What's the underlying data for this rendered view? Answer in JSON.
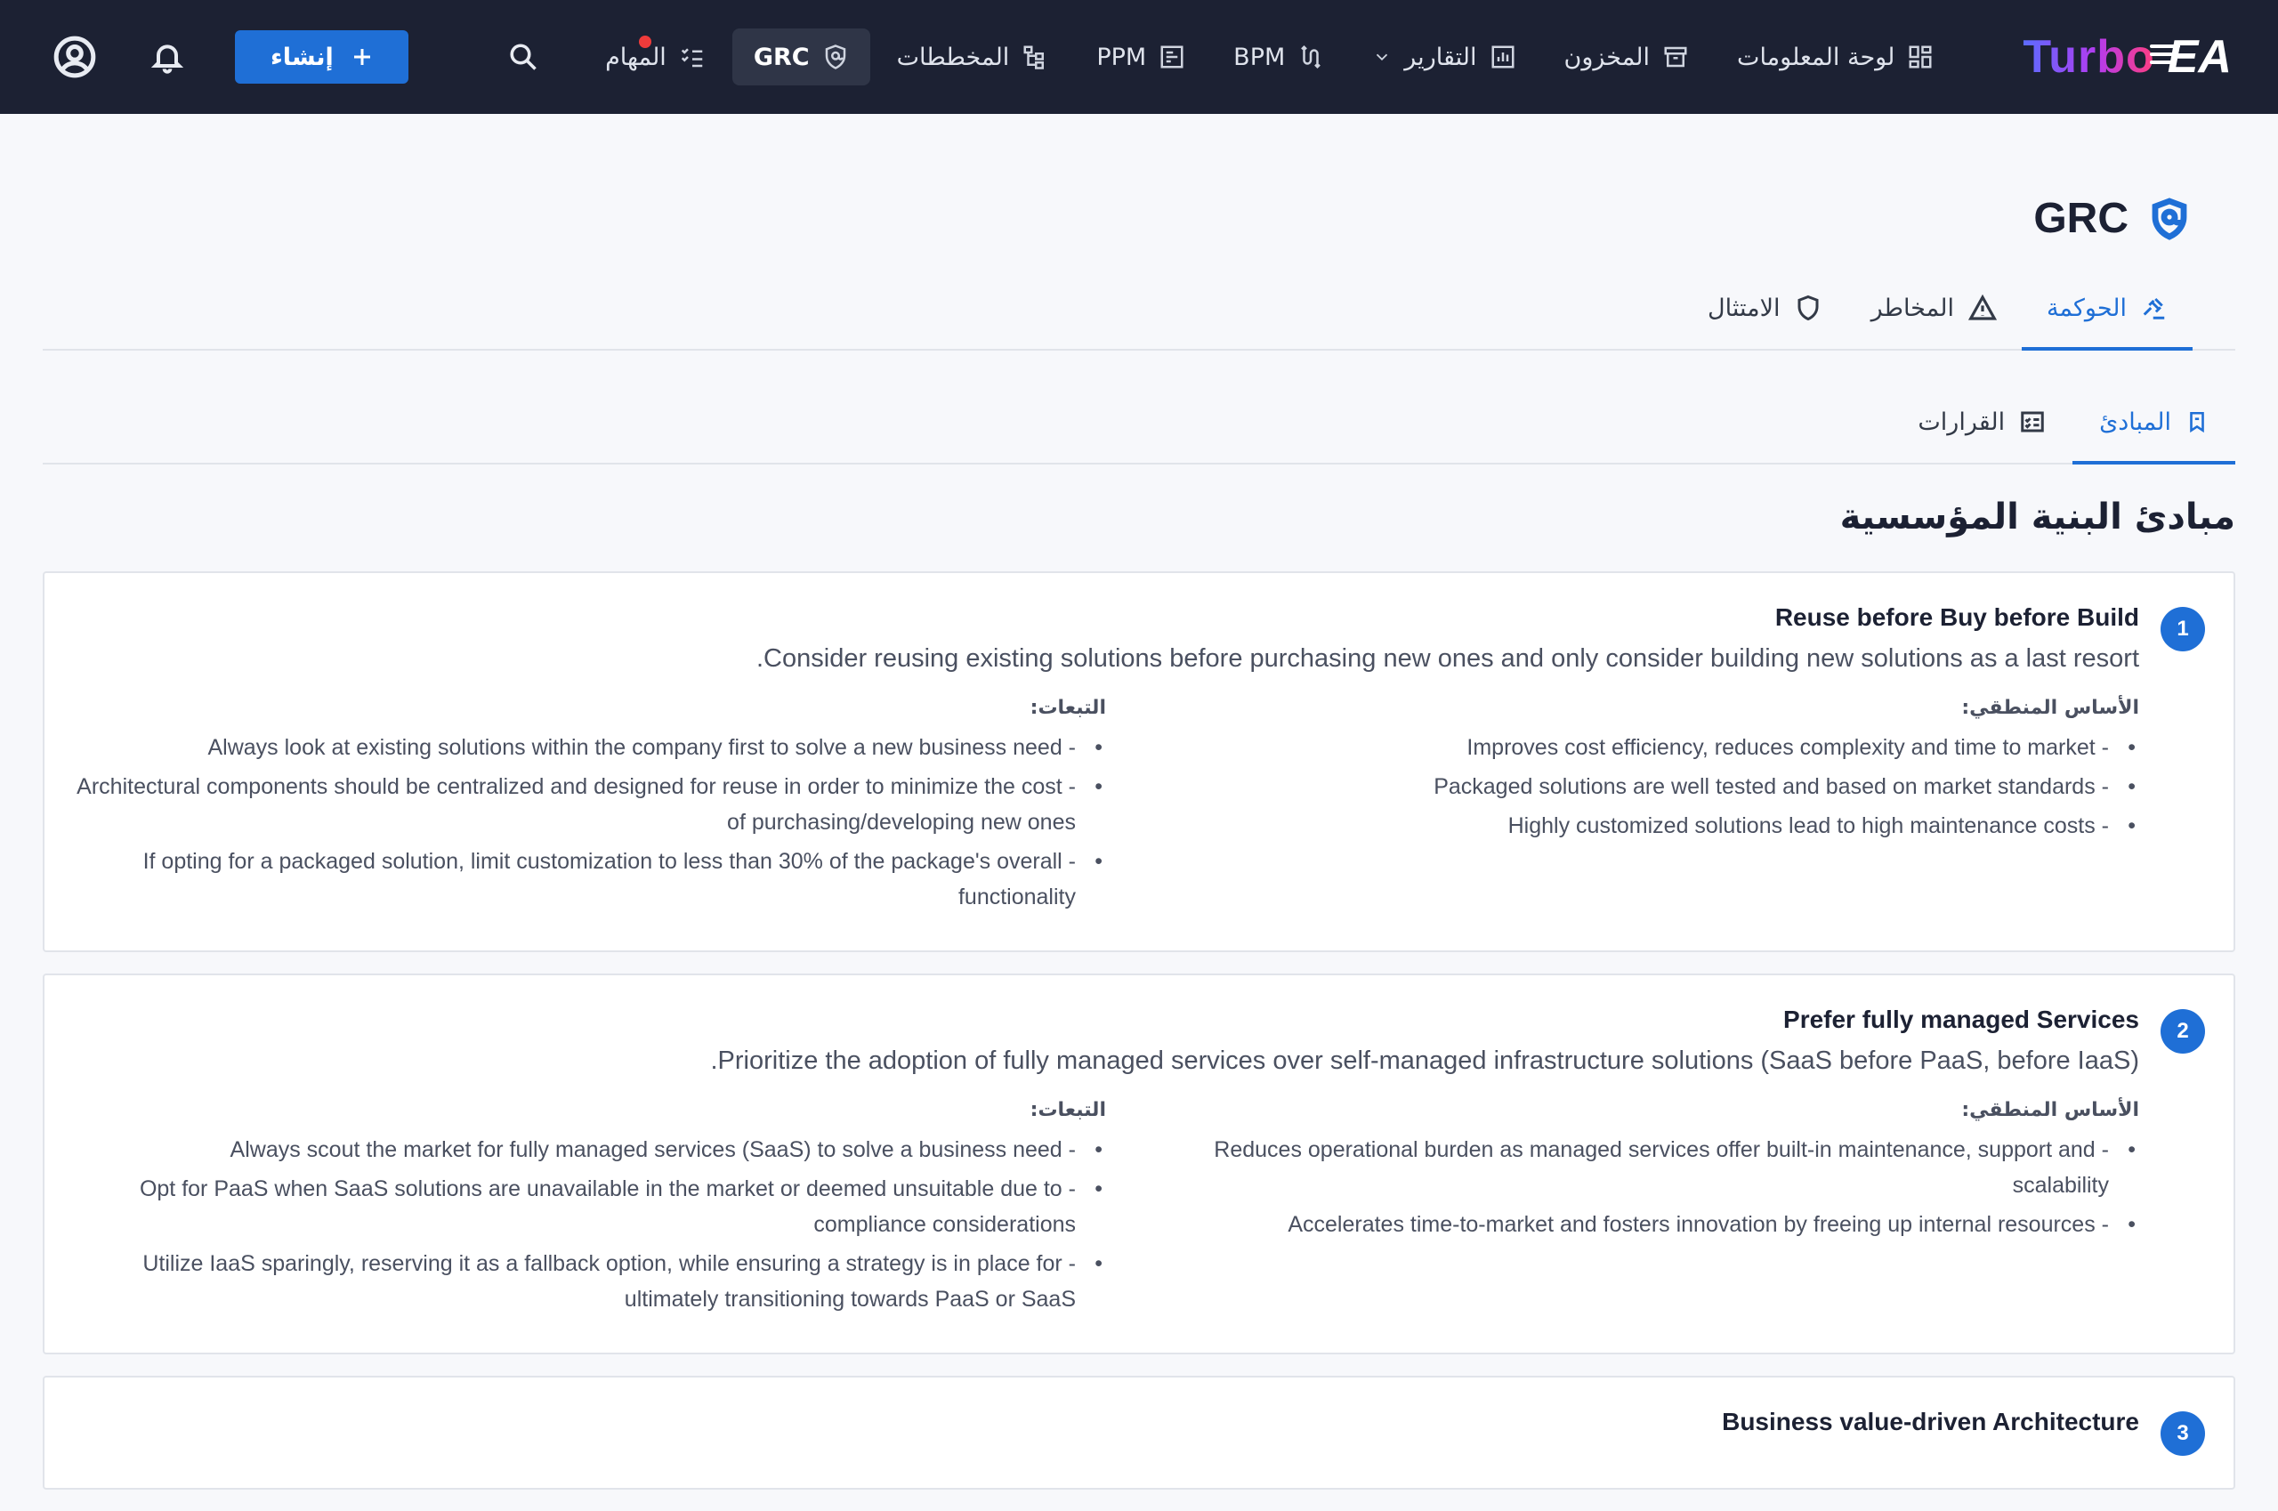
{
  "app": {
    "logo_primary": "Turbo",
    "logo_secondary": "EA"
  },
  "nav": {
    "items": [
      {
        "label": "لوحة المعلومات",
        "icon": "dashboard-icon"
      },
      {
        "label": "المخزون",
        "icon": "archive-icon"
      },
      {
        "label": "التقارير",
        "icon": "bar-chart-icon"
      },
      {
        "label": "BPM",
        "icon": "route-icon"
      },
      {
        "label": "PPM",
        "icon": "kanban-icon"
      },
      {
        "label": "المخططات",
        "icon": "diagram-icon"
      },
      {
        "label": "GRC",
        "icon": "shield-icon"
      },
      {
        "label": "المهام",
        "icon": "checklist-icon"
      }
    ],
    "create_label": "إنشاء"
  },
  "page": {
    "title": "GRC",
    "tabs": [
      {
        "label": "الحوكمة",
        "icon": "gavel-icon"
      },
      {
        "label": "المخاطر",
        "icon": "warning-icon"
      },
      {
        "label": "الامتثال",
        "icon": "shield-outline-icon"
      }
    ],
    "subtabs": [
      {
        "label": "المبادئ",
        "icon": "bookmark-icon"
      },
      {
        "label": "القرارات",
        "icon": "checklist-box-icon"
      }
    ],
    "section_title": "مبادئ البنية المؤسسية"
  },
  "principles": [
    {
      "number": "1",
      "title": "Reuse before Buy before Build",
      "description": "Consider reusing existing solutions before purchasing new ones and only consider building new solutions as a last resort.",
      "rationale_label": "الأساس المنطقي:",
      "rationale": [
        "- Improves cost efficiency, reduces complexity and time to market",
        "- Packaged solutions are well tested and based on market standards",
        "- Highly customized solutions lead to high maintenance costs"
      ],
      "implications_label": "التبعات:",
      "implications": [
        "- Always look at existing solutions within the company first to solve a new business need",
        "- Architectural components should be centralized and designed for reuse in order to minimize the cost of purchasing/developing new ones",
        "- If opting for a packaged solution, limit customization to less than 30% of the package's overall functionality"
      ]
    },
    {
      "number": "2",
      "title": "Prefer fully managed Services",
      "description": "Prioritize the adoption of fully managed services over self-managed infrastructure solutions (SaaS before PaaS, before IaaS).",
      "rationale_label": "الأساس المنطقي:",
      "rationale": [
        "- Reduces operational burden as managed services offer built-in maintenance, support and scalability",
        "- Accelerates time-to-market and fosters innovation by freeing up internal resources"
      ],
      "implications_label": "التبعات:",
      "implications": [
        "- Always scout the market for fully managed services (SaaS) to solve a business need",
        "- Opt for PaaS when SaaS solutions are unavailable in the market or deemed unsuitable due to compliance considerations",
        "- Utilize IaaS sparingly, reserving it as a fallback option, while ensuring a strategy is in place for ultimately transitioning towards PaaS or SaaS"
      ]
    },
    {
      "number": "3",
      "title": "Business value-driven Architecture"
    }
  ]
}
